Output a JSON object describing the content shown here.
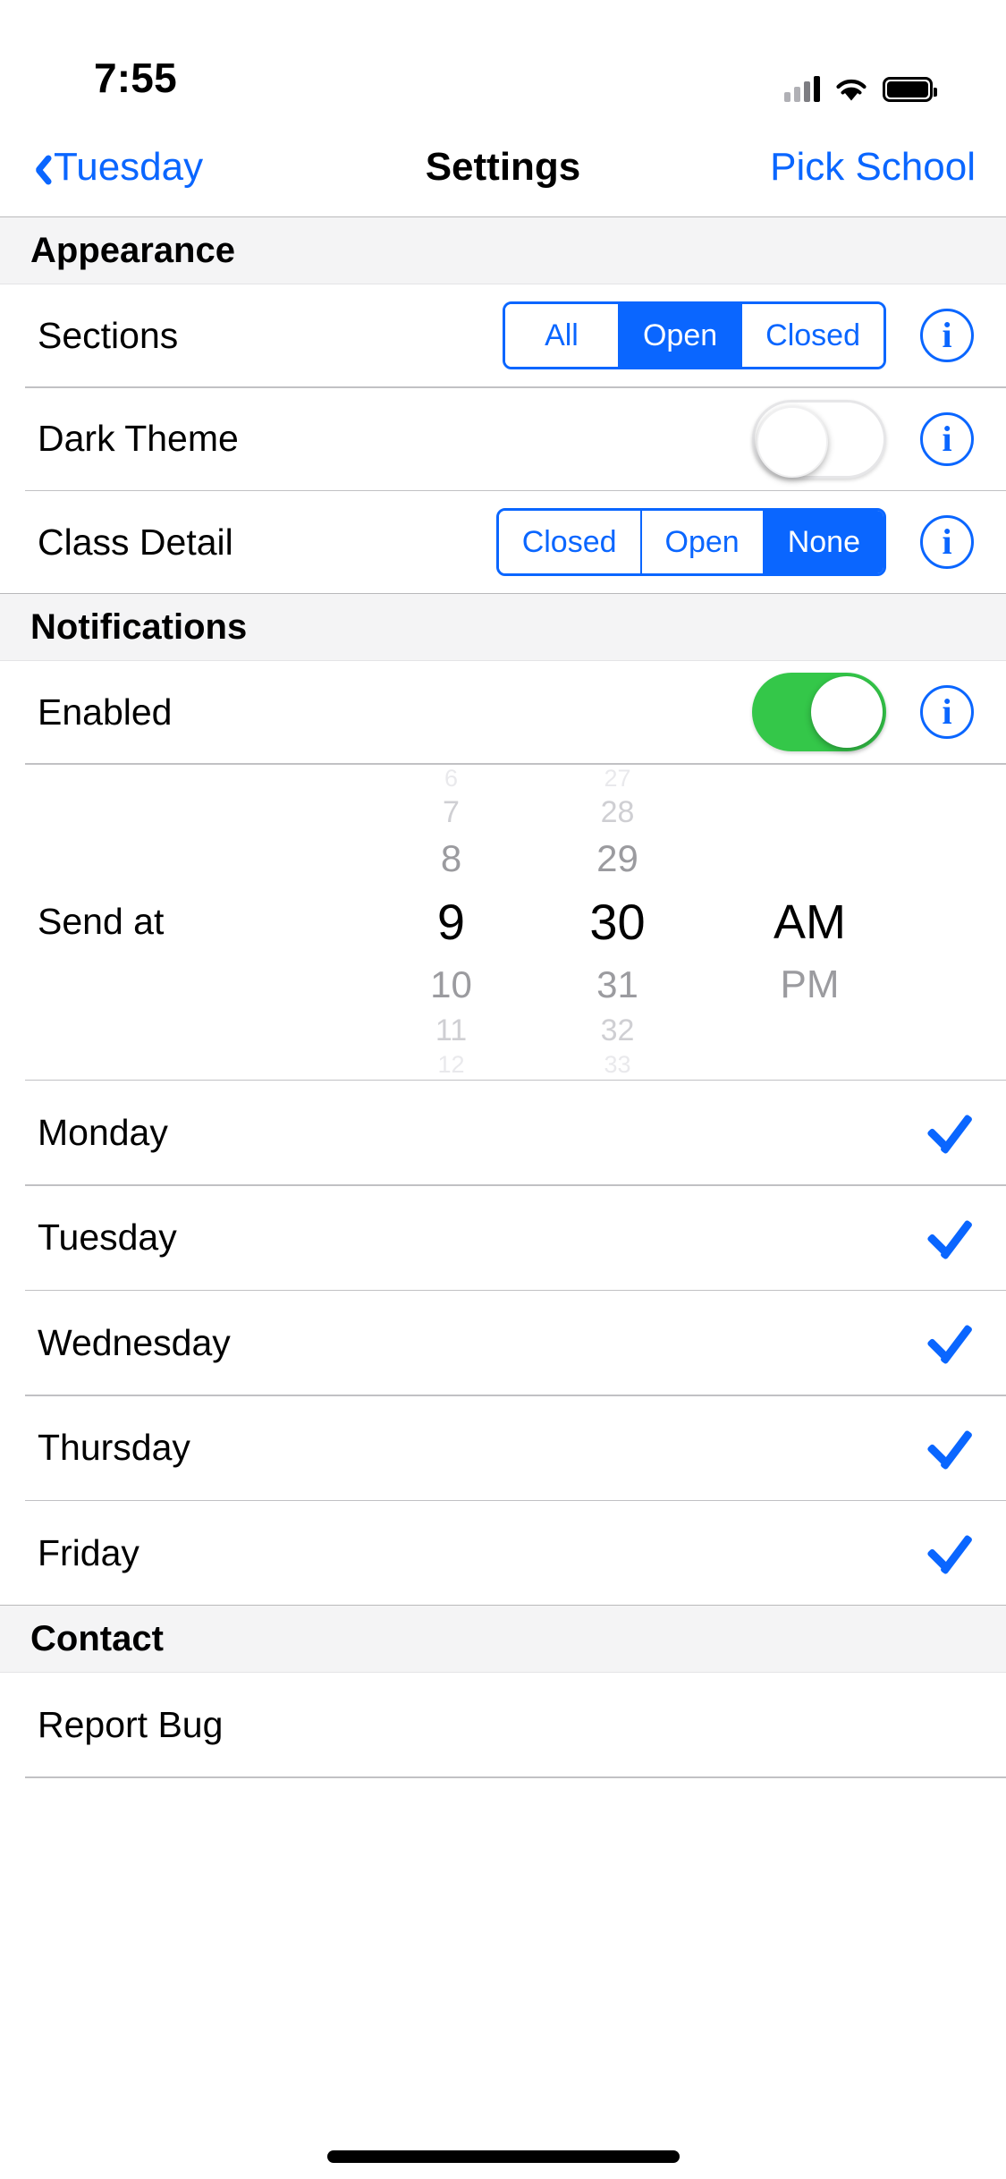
{
  "status_bar": {
    "time": "7:55",
    "signal_icon": "cellular-signal-icon",
    "wifi_icon": "wifi-icon",
    "battery_icon": "battery-full-icon"
  },
  "nav_bar": {
    "back_label": "Tuesday",
    "back_icon": "chevron-left-icon",
    "title": "Settings",
    "right_action": "Pick School"
  },
  "sections": [
    {
      "header": "Appearance"
    },
    {
      "header": "Notifications"
    },
    {
      "header": "Contact"
    }
  ],
  "appearance": {
    "header": "Appearance",
    "sections_row": {
      "label": "Sections",
      "options": [
        "All",
        "Open",
        "Closed"
      ],
      "selected": "Open",
      "info_icon": "info-circle-icon",
      "info_glyph": "i"
    },
    "dark_theme_row": {
      "label": "Dark Theme",
      "toggle_state": "off",
      "info_icon": "info-circle-icon",
      "info_glyph": "i"
    },
    "class_detail_row": {
      "label": "Class Detail",
      "options": [
        "Closed",
        "Open",
        "None"
      ],
      "selected": "None",
      "info_icon": "info-circle-icon",
      "info_glyph": "i"
    }
  },
  "notifications": {
    "header": "Notifications",
    "enabled_row": {
      "label": "Enabled",
      "toggle_state": "on",
      "info_icon": "info-circle-icon",
      "info_glyph": "i"
    },
    "send_at": {
      "label": "Send at",
      "hours": {
        "above": [
          "6",
          "7",
          "8"
        ],
        "selected": "9",
        "below": [
          "10",
          "11",
          "12"
        ]
      },
      "minutes": {
        "above": [
          "27",
          "28",
          "29"
        ],
        "selected": "30",
        "below": [
          "31",
          "32",
          "33"
        ]
      },
      "meridiem": {
        "selected": "AM",
        "below": [
          "PM"
        ]
      }
    },
    "days": [
      {
        "label": "Monday",
        "checked": true,
        "check_icon": "checkmark-icon"
      },
      {
        "label": "Tuesday",
        "checked": true,
        "check_icon": "checkmark-icon"
      },
      {
        "label": "Wednesday",
        "checked": true,
        "check_icon": "checkmark-icon"
      },
      {
        "label": "Thursday",
        "checked": true,
        "check_icon": "checkmark-icon"
      },
      {
        "label": "Friday",
        "checked": true,
        "check_icon": "checkmark-icon"
      }
    ]
  },
  "contact": {
    "header": "Contact",
    "items": [
      {
        "label": "Report Bug"
      }
    ]
  },
  "colors": {
    "accent_blue": "#0a66ff",
    "toggle_green": "#34c749",
    "section_header_bg": "#f4f4f5",
    "separator": "#8e8e93",
    "text_primary": "#000000"
  }
}
